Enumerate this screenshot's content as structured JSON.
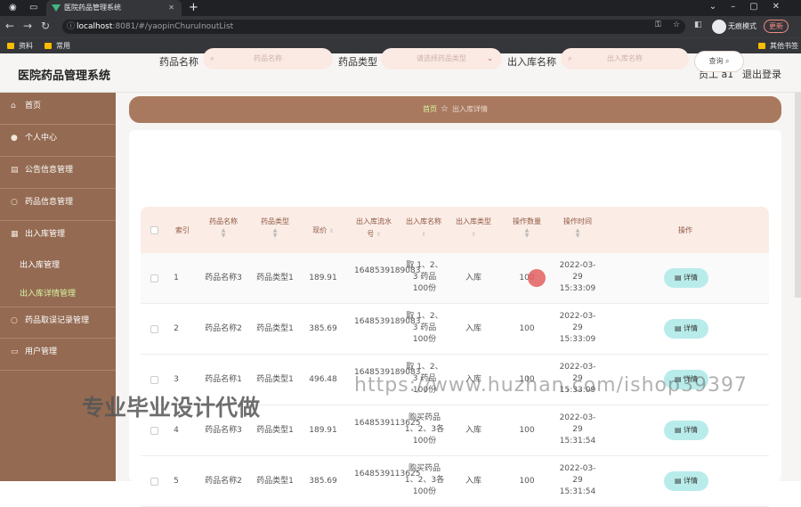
{
  "browser": {
    "tab_title": "医院药品管理系统",
    "url_host": "localhost",
    "url_path": ":8081/#/yaopinChuruInoutList",
    "incognito_label": "无痕模式",
    "update_label": "更新",
    "bookmarks": [
      "资料",
      "常用"
    ],
    "other_bookmarks": "其他书签"
  },
  "header": {
    "title": "医院药品管理系统",
    "user": "员工 a1",
    "logout": "退出登录"
  },
  "sidebar": {
    "items": [
      {
        "label": "首页",
        "icon": "home-icon"
      },
      {
        "label": "个人中心",
        "icon": "user-icon"
      },
      {
        "label": "公告信息管理",
        "icon": "notice-icon"
      },
      {
        "label": "药品信息管理",
        "icon": "medicine-icon"
      },
      {
        "label": "出入库管理",
        "icon": "warehouse-icon"
      },
      {
        "label": "药品取误记录管理",
        "icon": "record-icon"
      },
      {
        "label": "用户管理",
        "icon": "users-icon"
      }
    ],
    "subitems": [
      "出入库管理",
      "出入库详情管理"
    ]
  },
  "breadcrumb": {
    "home": "首页",
    "current": "出入库详情"
  },
  "search": {
    "name_label": "药品名称",
    "name_placeholder": "药品名称",
    "type_label": "药品类型",
    "type_placeholder": "请选择药品类型",
    "inout_label": "出入库名称",
    "inout_placeholder": "出入库名称",
    "query_button": "查询"
  },
  "table": {
    "headers": [
      "索引",
      "药品名称",
      "药品类型",
      "现价",
      "出入库流水号",
      "出入库名称",
      "出入库类型",
      "操作数量",
      "操作时间",
      "操作"
    ],
    "detail_label": "详情",
    "rows": [
      {
        "idx": "1",
        "name": "药品名称3",
        "type": "药品类型1",
        "price": "189.91",
        "serial": "1648539189083",
        "inout": "取 1、2、3 药品 100份",
        "kind": "入库",
        "qty": "100",
        "time": "2022-03-29 15:33:09"
      },
      {
        "idx": "2",
        "name": "药品名称2",
        "type": "药品类型1",
        "price": "385.69",
        "serial": "1648539189083",
        "inout": "取 1、2、3 药品 100份",
        "kind": "入库",
        "qty": "100",
        "time": "2022-03-29 15:33:09"
      },
      {
        "idx": "3",
        "name": "药品名称1",
        "type": "药品类型1",
        "price": "496.48",
        "serial": "1648539189083",
        "inout": "取 1、2、3 药品 100份",
        "kind": "入库",
        "qty": "100",
        "time": "2022-03-29 15:33:09"
      },
      {
        "idx": "4",
        "name": "药品名称3",
        "type": "药品类型1",
        "price": "189.91",
        "serial": "1648539113625",
        "inout": "购买药品1、2、3各100份",
        "kind": "入库",
        "qty": "100",
        "time": "2022-03-29 15:31:54"
      },
      {
        "idx": "5",
        "name": "药品名称2",
        "type": "药品类型1",
        "price": "385.69",
        "serial": "1648539113625",
        "inout": "购买药品1、2、3各100份",
        "kind": "入库",
        "qty": "100",
        "time": "2022-03-29 15:31:54"
      }
    ]
  },
  "watermark": {
    "left": "专业毕业设计代做",
    "right": "https://www.huzhan.com/ishop39397"
  }
}
